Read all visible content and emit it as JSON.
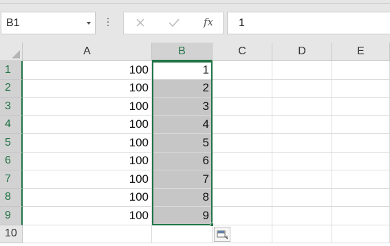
{
  "name_box": {
    "value": "B1"
  },
  "formula_bar": {
    "fx_label": "fx",
    "value": "1",
    "cancel_icon": "x-icon",
    "enter_icon": "check-icon"
  },
  "columns": [
    "A",
    "B",
    "C",
    "D",
    "E"
  ],
  "selected_column": "B",
  "rows": [
    "1",
    "2",
    "3",
    "4",
    "5",
    "6",
    "7",
    "8",
    "9",
    "10"
  ],
  "cells": {
    "A": [
      "100",
      "100",
      "100",
      "100",
      "100",
      "100",
      "100",
      "100",
      "100",
      ""
    ],
    "B": [
      "1",
      "2",
      "3",
      "4",
      "5",
      "6",
      "7",
      "8",
      "9",
      ""
    ]
  },
  "selection": "B1:B9",
  "active_cell": "B1",
  "colors": {
    "accent": "#217346",
    "selection_fill": "#c6c6c6",
    "header_bg": "#e6e6e6"
  },
  "quick_analysis_icon": "quick-analysis-icon"
}
